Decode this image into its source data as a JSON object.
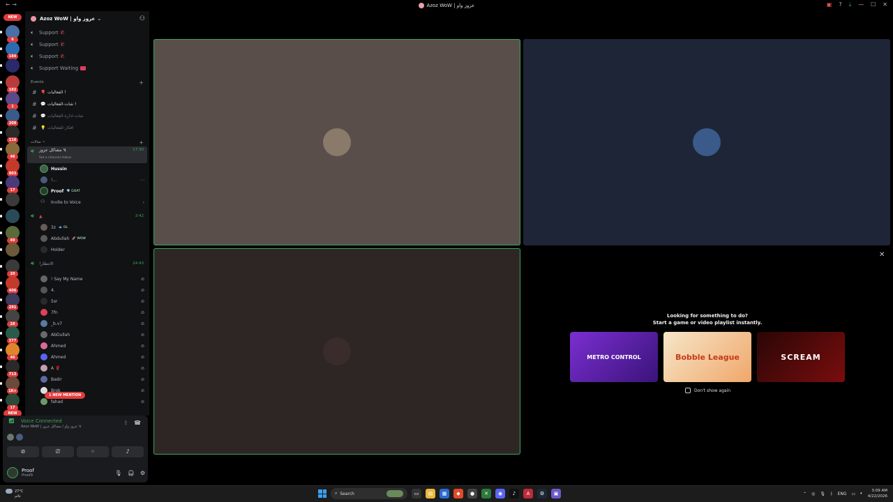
{
  "window": {
    "title": "Azoz WoW | عزوز واو"
  },
  "guilds": [
    {
      "badge": "NEW",
      "kind": "pill"
    },
    {
      "badge": "6",
      "color": "#4a6fa5"
    },
    {
      "badge": "184",
      "color": "#2b6cb0"
    },
    {
      "badge": "",
      "color": "#2a2a6a"
    },
    {
      "badge": "182",
      "color": "#b83a3a"
    },
    {
      "badge": "1",
      "color": "#5a4a8a"
    },
    {
      "badge": "209",
      "color": "#3a5a8a"
    },
    {
      "badge": "116",
      "color": "#2a2a2a"
    },
    {
      "badge": "46",
      "color": "#8a6a3a"
    },
    {
      "badge": "803",
      "color": "#c23a2a"
    },
    {
      "badge": "17",
      "color": "#4a3a7a"
    },
    {
      "badge": "",
      "color": "#3a3a3a"
    },
    {
      "badge": "",
      "color": "#2a4a5a"
    },
    {
      "badge": "49",
      "color": "#5a6a3a"
    },
    {
      "badge": "",
      "color": "#6a5a3a"
    },
    {
      "badge": "20",
      "color": "#3a3a3a"
    },
    {
      "badge": "406",
      "color": "#c23a2a"
    },
    {
      "badge": "291",
      "color": "#3a3a5a"
    },
    {
      "badge": "28",
      "color": "#444"
    },
    {
      "badge": "377",
      "color": "#2a5a4a"
    },
    {
      "badge": "40",
      "color": "#e0862a"
    },
    {
      "badge": "713",
      "color": "#2a2a2a"
    },
    {
      "badge": "1K+",
      "color": "#6a4a3a"
    },
    {
      "badge": "17",
      "color": "#2a4a3a"
    },
    {
      "badge": "NEW",
      "kind": "pill"
    }
  ],
  "sidebar": {
    "server_name": "Azoz WoW | عزوز واو",
    "voice_channels_top": [
      "Support",
      "Support",
      "Support",
      "Support Waiting"
    ],
    "category_events": "Events",
    "text_channels": [
      {
        "name": "الفعاليات !",
        "emoji": "🎈"
      },
      {
        "name": "شات-الفعاليات !",
        "emoji": "💬"
      },
      {
        "name": "شات-ادارة-الفعاليات",
        "emoji": "💬",
        "muted": true
      },
      {
        "name": "افكار-للفعاليات",
        "emoji": "💡",
        "muted": true
      }
    ],
    "category_voice": "صالات ~",
    "voice1": {
      "name": "مشاكل عزوز ↯",
      "time": "17:30",
      "status": "Set a channel status"
    },
    "voice1_members": [
      {
        "name": "Hussin",
        "bold": true,
        "tag": ""
      },
      {
        "name": "!...",
        "bold": false,
        "tag": ""
      },
      {
        "name": "Proof",
        "bold": true,
        "tag": "💎 GOAT"
      },
      {
        "name": "Invite to Voice",
        "bold": false,
        "tag": ""
      }
    ],
    "voice2": {
      "name": "▲",
      "time": "3:42"
    },
    "voice2_members": [
      {
        "name": "3z",
        "tag": "🐟 OL"
      },
      {
        "name": "Abdullah",
        "tag": "🚀 WOW"
      },
      {
        "name": "Holder",
        "tag": ""
      }
    ],
    "voice3": {
      "name": "!الانتظار",
      "time": "24:43"
    },
    "voice3_members": [
      "! Say My Name",
      "4.",
      "5sr",
      "7fn",
      "_b.v7",
      "AbDullah",
      "Ahmed",
      "Ahmed",
      "A 🌹",
      "Badir",
      "Brok",
      "fahad"
    ],
    "mention_label": "1 NEW MENTION"
  },
  "panel": {
    "voice_connected": "Voice Connected",
    "voice_sub": "Azoz WoW | عزوز واو / مشاكل عزوز ↯",
    "user_name": "Proof",
    "user_sub": "Proof9"
  },
  "stage": {
    "activity_line1": "Looking for something to do?",
    "activity_line2": "Start a game or video playlist instantly.",
    "card1": "METRO CONTROL",
    "card2": "Bobble League",
    "card3": "SCREAM",
    "dont_show": "Don't show again"
  },
  "taskbar": {
    "temp": "27°C",
    "weather": "غائم",
    "search": "Search",
    "lang": "ENG",
    "time": "3:09 AM",
    "date": "4/22/2026"
  }
}
